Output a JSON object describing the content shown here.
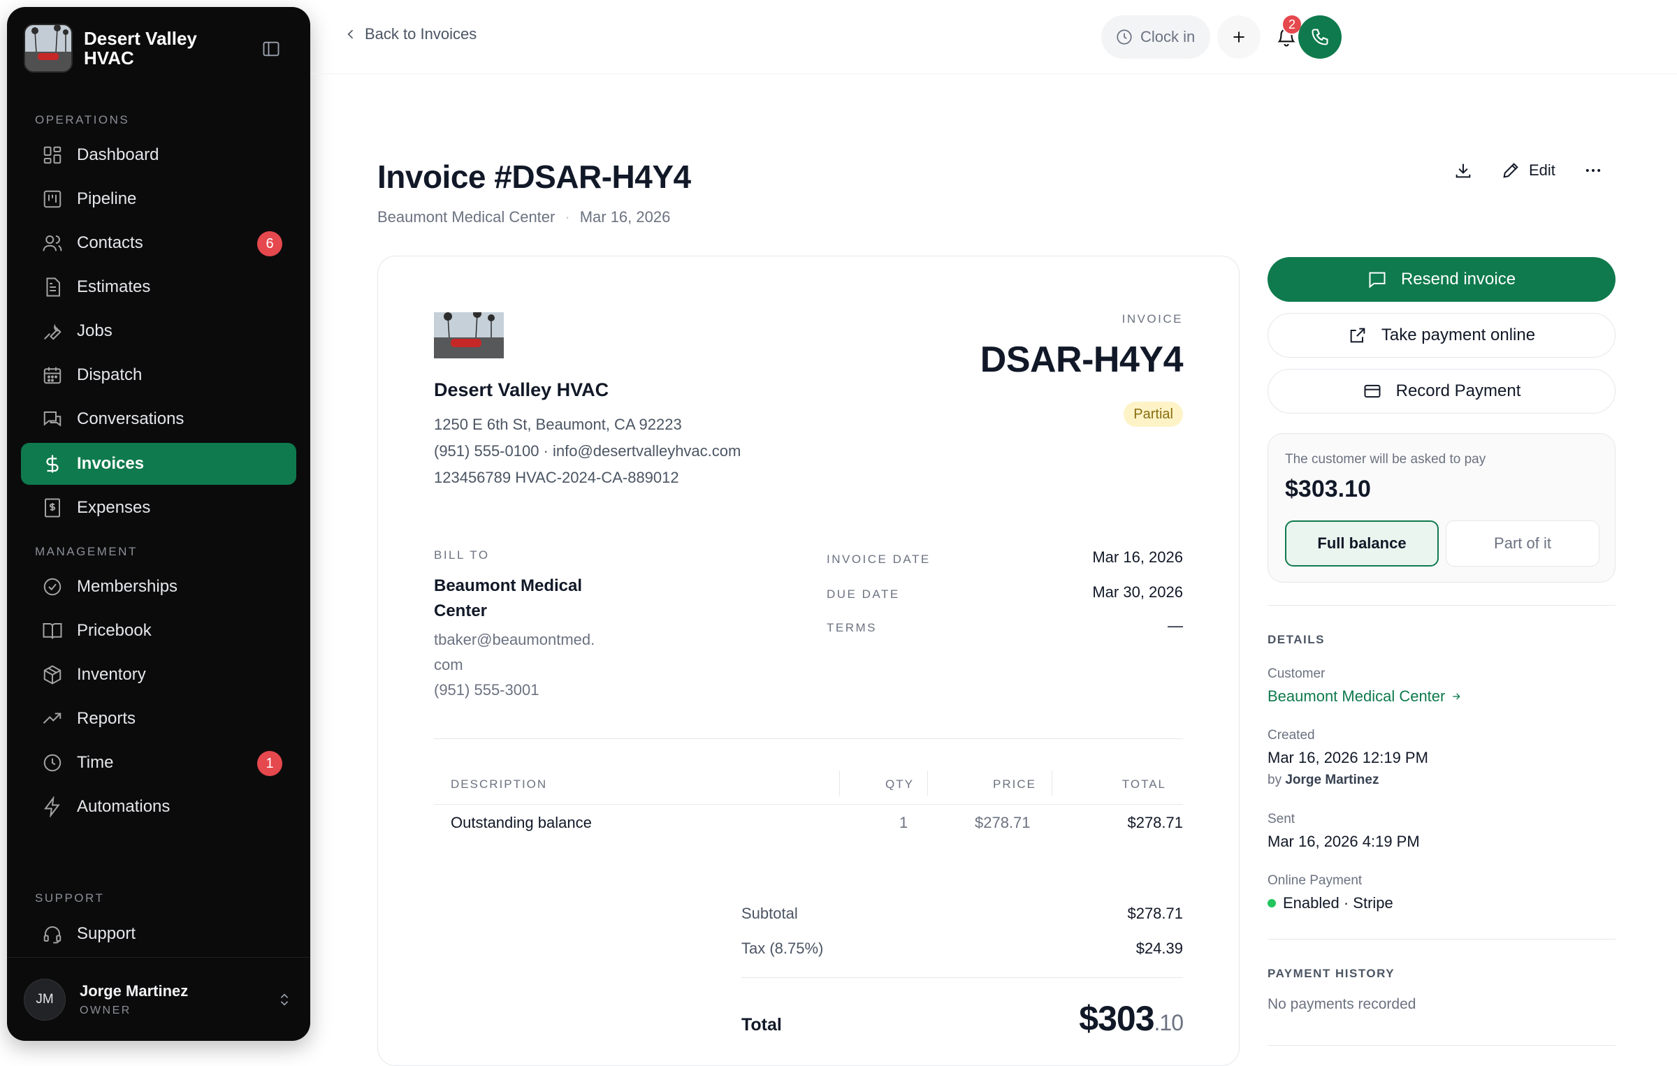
{
  "brand": {
    "name": "Desert Valley HVAC"
  },
  "sidebar": {
    "sections": {
      "operations": "OPERATIONS",
      "management": "MANAGEMENT",
      "support": "SUPPORT"
    },
    "items": [
      {
        "label": "Dashboard",
        "icon": "dashboard-icon"
      },
      {
        "label": "Pipeline",
        "icon": "pipeline-icon"
      },
      {
        "label": "Contacts",
        "icon": "contacts-icon",
        "badge": "6"
      },
      {
        "label": "Estimates",
        "icon": "document-icon"
      },
      {
        "label": "Jobs",
        "icon": "wrench-icon"
      },
      {
        "label": "Dispatch",
        "icon": "calendar-icon"
      },
      {
        "label": "Conversations",
        "icon": "chat-icon"
      },
      {
        "label": "Invoices",
        "icon": "dollar-icon",
        "active": true
      },
      {
        "label": "Expenses",
        "icon": "receipt-icon"
      },
      {
        "label": "Memberships",
        "icon": "badge-check-icon"
      },
      {
        "label": "Pricebook",
        "icon": "book-icon"
      },
      {
        "label": "Inventory",
        "icon": "box-icon"
      },
      {
        "label": "Reports",
        "icon": "trend-icon"
      },
      {
        "label": "Time",
        "icon": "clock-icon",
        "badge": "1"
      },
      {
        "label": "Automations",
        "icon": "bolt-icon"
      },
      {
        "label": "Support",
        "icon": "headset-icon"
      }
    ],
    "user": {
      "initials": "JM",
      "name": "Jorge Martinez",
      "role": "OWNER"
    }
  },
  "topbar": {
    "back_label": "Back to Invoices",
    "clock_in_label": "Clock in",
    "notification_count": "2"
  },
  "header": {
    "title": "Invoice #DSAR-H4Y4",
    "customer": "Beaumont Medical Center",
    "date": "Mar 16, 2026",
    "edit_label": "Edit"
  },
  "invoice": {
    "company": {
      "name": "Desert Valley HVAC",
      "address": "1250 E 6th St, Beaumont, CA 92223",
      "contact": "(951) 555-0100 · info@desertvalleyhvac.com",
      "license": "123456789 HVAC-2024-CA-889012"
    },
    "label": "INVOICE",
    "number": "DSAR-H4Y4",
    "status": "Partial",
    "bill_to": {
      "label": "BILL TO",
      "name": "Beaumont Medical Center",
      "email_line1": "tbaker@beaumontmed.",
      "email_line2": "com",
      "phone": "(951) 555-3001"
    },
    "meta": {
      "invoice_date_label": "INVOICE DATE",
      "invoice_date": "Mar 16, 2026",
      "due_date_label": "DUE DATE",
      "due_date": "Mar 30, 2026",
      "terms_label": "TERMS",
      "terms": "—"
    },
    "table": {
      "headers": {
        "description": "DESCRIPTION",
        "qty": "QTY",
        "price": "PRICE",
        "total": "TOTAL"
      },
      "rows": [
        {
          "description": "Outstanding balance",
          "qty": "1",
          "price": "$278.71",
          "total": "$278.71"
        }
      ]
    },
    "totals": {
      "subtotal_label": "Subtotal",
      "subtotal": "$278.71",
      "tax_label": "Tax (8.75%)",
      "tax": "$24.39",
      "total_label": "Total",
      "total_dollars": "$303",
      "total_cents": ".10"
    }
  },
  "actions": {
    "resend": "Resend invoice",
    "take_payment": "Take payment online",
    "record_payment": "Record Payment"
  },
  "payment_box": {
    "note": "The customer will be asked to pay",
    "amount": "$303.10",
    "full_balance": "Full balance",
    "part": "Part of it"
  },
  "details": {
    "section": "DETAILS",
    "customer_label": "Customer",
    "customer": "Beaumont Medical Center",
    "created_label": "Created",
    "created": "Mar 16, 2026 12:19 PM",
    "created_by_prefix": "by",
    "created_by": "Jorge Martinez",
    "sent_label": "Sent",
    "sent": "Mar 16, 2026 4:19 PM",
    "online_payment_label": "Online Payment",
    "online_payment": "Enabled · Stripe"
  },
  "payment_history": {
    "section": "PAYMENT HISTORY",
    "empty": "No payments recorded"
  },
  "colors": {
    "accent": "#0f7a4d",
    "badge": "#e5484d",
    "sidebar_bg": "#0b0b0c"
  }
}
